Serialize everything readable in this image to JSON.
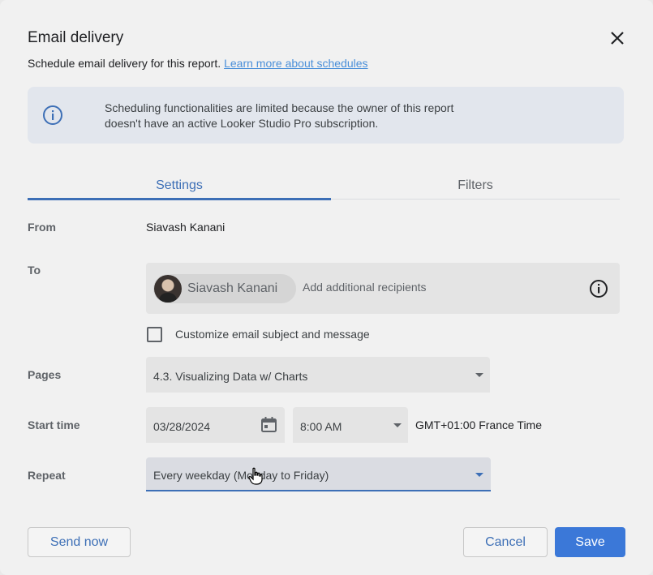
{
  "dialog": {
    "title": "Email delivery",
    "subtitle": "Schedule email delivery for this report.",
    "learn_more_link": "Learn more about schedules"
  },
  "banner": {
    "icon": "info-icon",
    "text": "Scheduling functionalities are limited because the owner of this report doesn't have an active Looker Studio Pro subscription."
  },
  "tabs": [
    {
      "label": "Settings",
      "active": true
    },
    {
      "label": "Filters",
      "active": false
    }
  ],
  "form": {
    "from": {
      "label": "From",
      "value": "Siavash Kanani"
    },
    "to": {
      "label": "To",
      "recipient_chip": "Siavash Kanani",
      "placeholder": "Add additional recipients"
    },
    "customize": {
      "label": "Customize email subject and message",
      "checked": false
    },
    "pages": {
      "label": "Pages",
      "value": "4.3. Visualizing Data w/ Charts"
    },
    "start_time": {
      "label": "Start time",
      "date": "03/28/2024",
      "time": "8:00 AM",
      "timezone": "GMT+01:00 France Time"
    },
    "repeat": {
      "label": "Repeat",
      "value": "Every weekday (Monday to Friday)"
    }
  },
  "buttons": {
    "send_now": "Send now",
    "cancel": "Cancel",
    "save": "Save"
  },
  "colors": {
    "accent": "#3d6fb6",
    "primary_button": "#3b78d8",
    "banner_bg": "#e2e6ed"
  }
}
